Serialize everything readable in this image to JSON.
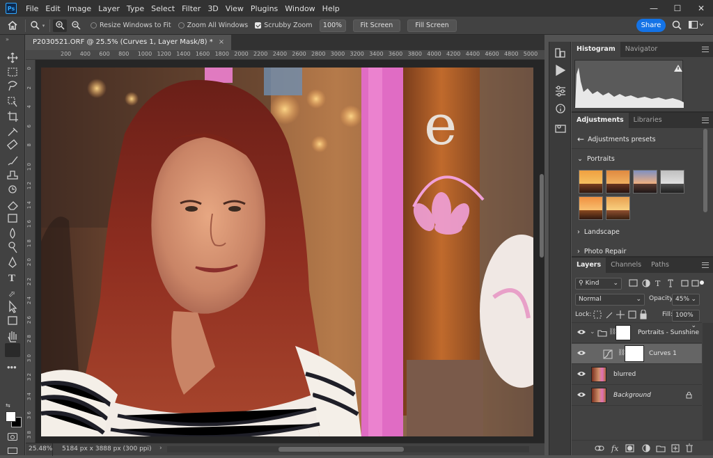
{
  "app": {
    "logo": "Ps"
  },
  "menu": [
    "File",
    "Edit",
    "Image",
    "Layer",
    "Type",
    "Select",
    "Filter",
    "3D",
    "View",
    "Plugins",
    "Window",
    "Help"
  ],
  "window_controls": {
    "minimize": "—",
    "maximize": "☐",
    "close": "✕"
  },
  "options_bar": {
    "resize_windows": "Resize Windows to Fit",
    "zoom_all": "Zoom All Windows",
    "scrubby_zoom": "Scrubby Zoom",
    "zoom_value": "100%",
    "fit_screen": "Fit Screen",
    "fill_screen": "Fill Screen",
    "share": "Share"
  },
  "document": {
    "tab_title": "P2030521.ORF @ 25.5% (Curves 1, Layer Mask/8) *",
    "tab_close": "×"
  },
  "ruler_h": [
    "200",
    "400",
    "600",
    "800",
    "1000",
    "1200",
    "1400",
    "1600",
    "1800",
    "2000",
    "2200",
    "2400",
    "2600",
    "2800",
    "3000",
    "3200",
    "3400",
    "3600",
    "3800",
    "4000",
    "4200",
    "4400",
    "4600",
    "4800",
    "5000"
  ],
  "ruler_v": [
    "0",
    "2",
    "4",
    "6",
    "8",
    "1 0",
    "1 2",
    "1 4",
    "1 6",
    "1 8",
    "2 0",
    "2 2",
    "2 4",
    "2 6",
    "2 8",
    "3 0",
    "3 2",
    "3 4",
    "3 6",
    "3 8"
  ],
  "status": {
    "zoom": "25.48%",
    "dimensions": "5184 px x 3888 px (300 ppi)"
  },
  "panel_top": {
    "tabs": [
      "Histogram",
      "Navigator"
    ]
  },
  "panel_adjust": {
    "tabs": [
      "Adjustments",
      "Libraries"
    ],
    "back_label": "Adjustments presets",
    "groups": [
      "Portraits",
      "Landscape",
      "Photo Repair"
    ]
  },
  "panel_layers": {
    "tabs": [
      "Layers",
      "Channels",
      "Paths"
    ],
    "filter_kind": "Kind",
    "blend_mode": "Normal",
    "opacity_label": "Opacity:",
    "opacity_value": "45%",
    "lock_label": "Lock:",
    "fill_label": "Fill:",
    "fill_value": "100%",
    "layers": [
      {
        "name": "Portraits - Sunshine"
      },
      {
        "name": "Curves 1"
      },
      {
        "name": "blurred"
      },
      {
        "name": "Background"
      }
    ]
  },
  "colors": {
    "accent": "#1473e6",
    "panel_bg": "#424242",
    "dark_bg": "#323232"
  }
}
